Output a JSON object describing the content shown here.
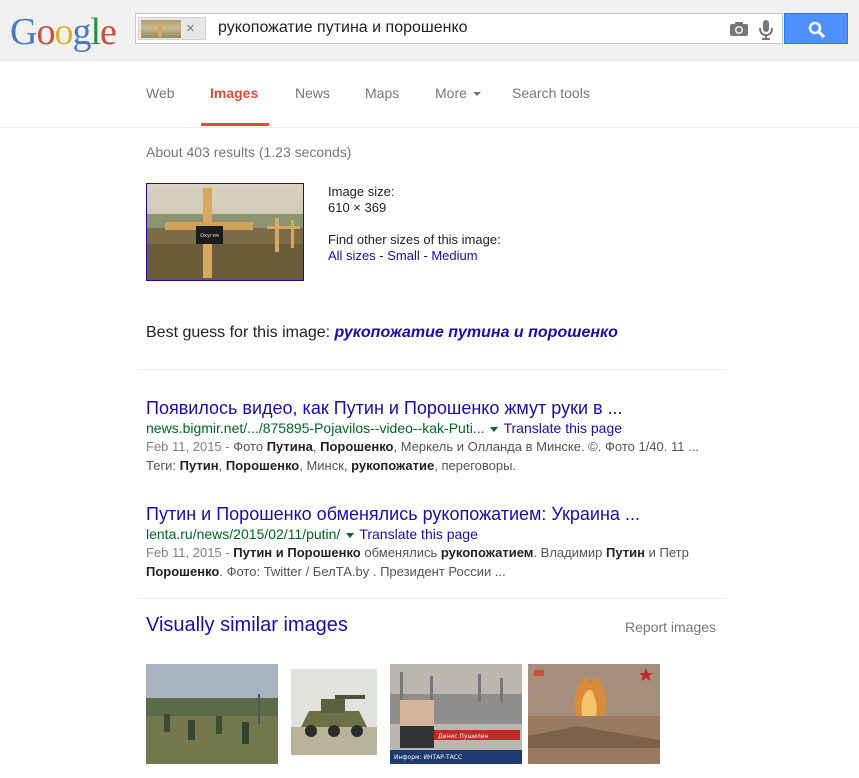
{
  "header": {
    "logo_text": "Google",
    "logo_letters": [
      "G",
      "o",
      "o",
      "g",
      "l",
      "e"
    ],
    "logo_colors": [
      "#4a7abf",
      "#c94f3e",
      "#e0b12f",
      "#4a7abf",
      "#2c8d46",
      "#c94f3e"
    ],
    "query": "рукопожатие путина и порошенко",
    "chip_remove": "×"
  },
  "tabs": [
    {
      "label": "Web"
    },
    {
      "label": "Images"
    },
    {
      "label": "News"
    },
    {
      "label": "Maps"
    },
    {
      "label": "More"
    },
    {
      "label": "Search tools"
    }
  ],
  "stats": "About 403 results (1.23 seconds)",
  "image_info": {
    "size_label": "Image size:",
    "size_value": "610 × 369",
    "find_label": "Find other sizes of this image:",
    "links": [
      "All sizes",
      "Small",
      "Medium"
    ],
    "separator": " - ",
    "sign_text": "Охугия"
  },
  "best_guess": {
    "prefix": "Best guess for this image: ",
    "query": "рукопожатие путина и порошенко"
  },
  "results": [
    {
      "title": "Появилось видео, как Путин и Порошенко жмут руки в ...",
      "url": "news.bigmir.net/.../875895-Pojavilos--video--kak-Puti...",
      "translate": "Translate this page",
      "date": "Feb 11, 2015 - ",
      "snippet_parts": [
        [
          "Фото ",
          false
        ],
        [
          "Путина",
          true
        ],
        [
          ", ",
          false
        ],
        [
          "Порошенко",
          true
        ],
        [
          ", Меркель и Олланда в Минске. ©. Фото 1/40. 11 ... Теги: ",
          false
        ],
        [
          "Путин",
          true
        ],
        [
          ", ",
          false
        ],
        [
          "Порошенко",
          true
        ],
        [
          ", Минск, ",
          false
        ],
        [
          "рукопожатие",
          true
        ],
        [
          ", переговоры.",
          false
        ]
      ]
    },
    {
      "title": "Путин и Порошенко обменялись рукопожатием: Украина ...",
      "url": "lenta.ru/news/2015/02/11/putin/",
      "translate": "Translate this page",
      "date": "Feb 11, 2015 - ",
      "snippet_parts": [
        [
          "Путин и Порошенко",
          true
        ],
        [
          " обменялись ",
          false
        ],
        [
          "рукопожатием",
          true
        ],
        [
          ". Владимир ",
          false
        ],
        [
          "Путин",
          true
        ],
        [
          " и Петр ",
          false
        ],
        [
          "Порошенко",
          true
        ],
        [
          ". Фото: Twitter / БелТА.by . Президент России ...",
          false
        ]
      ]
    }
  ],
  "similar": {
    "heading": "Visually similar images",
    "report": "Report images",
    "images": [
      {
        "name": "soldiers-field"
      },
      {
        "name": "armored-vehicle"
      },
      {
        "name": "news-broadcast",
        "caption": "Денис Пушилин",
        "ticker": "Информ: ИНТАР-ТАСС"
      },
      {
        "name": "explosion-field"
      }
    ]
  }
}
